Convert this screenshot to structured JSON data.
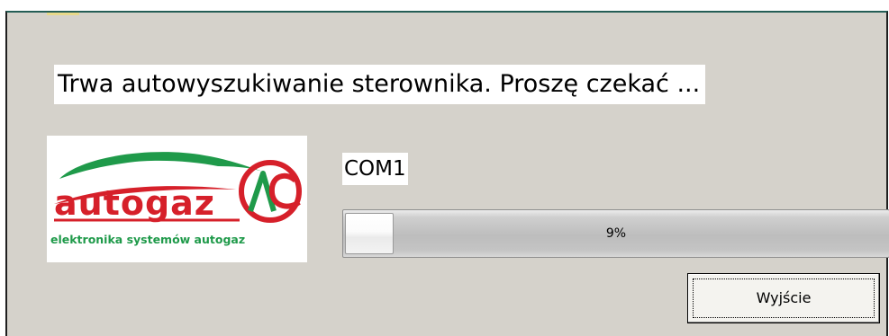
{
  "dialog": {
    "message": "Trwa autowyszukiwanie sterownika. Proszę czekać ...",
    "port": "COM1",
    "progress": {
      "value": 9,
      "text": "9%"
    },
    "exit_label": "Wyjście"
  },
  "logo": {
    "wordmark": "autogaz",
    "badge": "AC",
    "tagline": "elektronika systemów autogaz",
    "colors": {
      "red": "#d6202a",
      "green": "#1f9a4a"
    }
  }
}
